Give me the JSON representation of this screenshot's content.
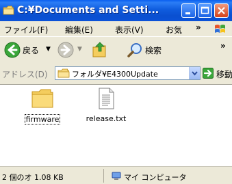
{
  "window": {
    "title": "C:¥Documents and Setti..."
  },
  "menu": {
    "items": [
      "ファイル(F)",
      "編集(E)",
      "表示(V)",
      "お気"
    ],
    "overflow": "»"
  },
  "toolbar": {
    "back_label": "戻る",
    "search_label": "検索",
    "overflow": "»"
  },
  "address": {
    "label": "アドレス(D)",
    "path": "フォルダ¥E4300Update",
    "go_label": "移動"
  },
  "files": [
    {
      "name": "firmware",
      "type": "folder",
      "icon": "folder-icon"
    },
    {
      "name": "release.txt",
      "type": "text",
      "icon": "text-file-icon"
    }
  ],
  "status": {
    "left_text": "2 個のオ 1.08 KB",
    "right_text": "マイ コンピュータ"
  },
  "colors": {
    "titlebar": "#0a5ff0",
    "chrome": "#ece9d8",
    "close_button": "#d6421a"
  }
}
